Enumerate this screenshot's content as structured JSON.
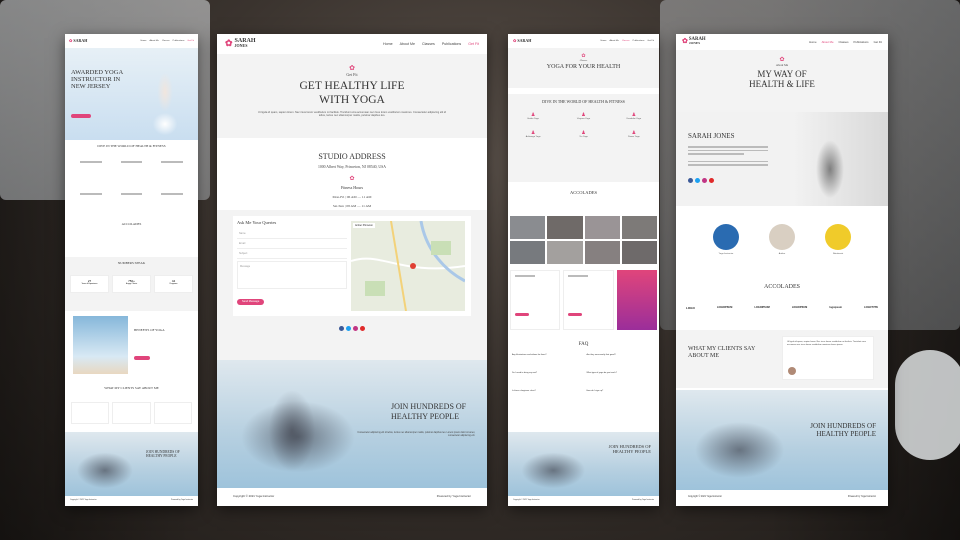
{
  "brand": {
    "line1": "SARAH",
    "line2": "JONES"
  },
  "nav": [
    "Home",
    "About Me",
    "Classes",
    "Publications",
    "Get Fit"
  ],
  "p1": {
    "hero": "AWARDED YOGA INSTRUCTOR IN NEW JERSEY",
    "dive": "DIVE IN THE WORLD OF HEALTH & FITNESS",
    "accolades": "ACCOLADES",
    "numbers": "NUMBERS SPEAK",
    "benefits": "BENEFITS OF YOGA",
    "clients": "WHAT MY CLIENTS SAY ABOUT ME",
    "join": "JOIN HUNDREDS OF HEALTHY PEOPLE",
    "stats": [
      {
        "v": "27",
        "l": "Years of Experience"
      },
      {
        "v": "750+",
        "l": "Happy Clients"
      },
      {
        "v": "44",
        "l": "Programs"
      }
    ]
  },
  "p2": {
    "kicker": "Get Fit",
    "title1": "GET HEALTHY LIFE",
    "title2": "WITH YOGA",
    "intro": "Ut ligula id quam, sapien lorem. Nec risus lorem vestibulum mi facilisis. Tincidunt urna accumsan nec risus lorem vestibulum maximus. Consectetur adipiscing elit id tellus, luctus nec ullamcorper mattis, pulvinar dapibus leo.",
    "studio": "STUDIO ADDRESS",
    "address": "1000 Albert Way, Princeton, NJ 08540, USA",
    "hours_title": "Fitness Hours",
    "hours": [
      "Mon-Fri | 06 AM — 11 AM",
      "Sat-Sun | 08 AM — 11 AM"
    ],
    "form_title": "Ask Me Your Queries",
    "form_fields": [
      "Name",
      "Email",
      "Subject",
      "Message"
    ],
    "form_button": "Send Message",
    "map_label": "Amber Princeton",
    "join1": "JOIN HUNDREDS OF",
    "join2": "HEALTHY PEOPLE",
    "join_text": "Consectetur adipiscing elit id tellus, luctus nec ullamcorper mattis, pulvinar dapibus leo. Lorem ipsum dolor sit amet, consectetur adipiscing elit.",
    "copyright": "Copyright © 2021 Yoga Instructor",
    "powered": "Powered by Yoga Instructor"
  },
  "p3": {
    "kicker": "Classes",
    "title": "YOGA FOR YOUR HEALTH",
    "dive": "DIVE IN THE WORLD OF HEALTH & FITNESS",
    "classes": [
      "Hatha Yoga",
      "Vinyasa Yoga",
      "Kundalini Yoga",
      "Ashtanga Yoga",
      "Yin Yoga",
      "Power Yoga"
    ],
    "accolades": "ACCOLADES",
    "faq": "FAQ",
    "faq_items": [
      "Any illustrations and videos for them?",
      "Are they necessarily that good?",
      "Do I need to bring my mat?",
      "What type of yoga do you teach?",
      "Is there a beginner class?",
      "How do I sign up?"
    ],
    "join1": "JOIN HUNDREDS OF",
    "join2": "HEALTHY PEOPLE",
    "copyright": "Copyright © 2021 Yoga Instructor",
    "powered": "Powered by Yoga Instructor"
  },
  "p4": {
    "kicker": "About Me",
    "title1": "MY WAY OF",
    "title2": "HEALTH & LIFE",
    "name": "SARAH JONES",
    "circles": [
      "Yoga Instructor",
      "Author",
      "Nutritionist"
    ],
    "accolades": "ACCOLADES",
    "logos": [
      "LOGO",
      "LOGOIPSUM",
      "LOGOIPSUM",
      "LOGOIPSUM",
      "logoipsum",
      "LOGOTYPE"
    ],
    "clients1": "WHAT MY CLIENTS SAY",
    "clients2": "ABOUT ME",
    "quote": "Ut ligula id quam, sapien lorem. Nec risus lorem vestibulum mi facilisis. Tincidunt urna accumsan nec risus lorem vestibulum maximus lorem ipsum.",
    "join1": "JOIN HUNDREDS OF",
    "join2": "HEALTHY PEOPLE",
    "copyright": "Copyright © 2021 Yoga Instructor",
    "powered": "Powered by Yoga Instructor"
  }
}
